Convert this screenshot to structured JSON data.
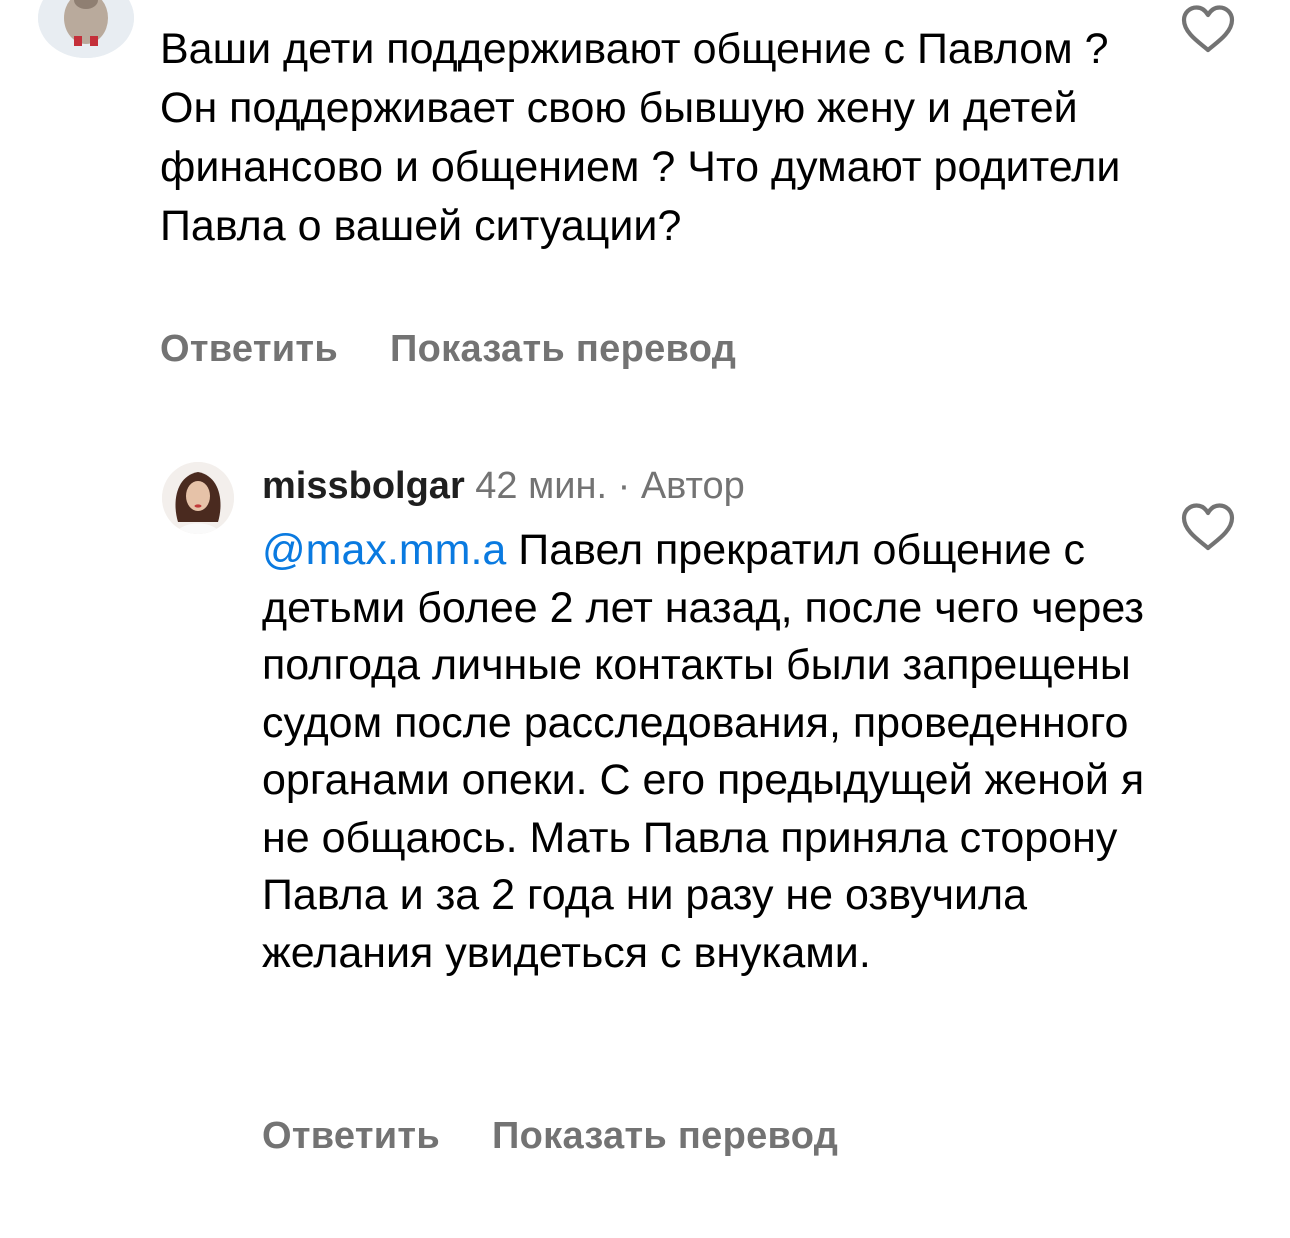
{
  "comments": [
    {
      "text": "Ваши дети поддерживают общение с Павлом ? Он поддерживает свою бывшую жену и детей финансово и общением ? Что думают родители Павла о вашей ситуации?",
      "actions": {
        "reply": "Ответить",
        "translate": "Показать перевод"
      }
    },
    {
      "username": "missbolgar",
      "time": "42 мин.",
      "separator": "·",
      "author_badge": "Автор",
      "mention": "@max.mm.a",
      "text": " Павел прекратил общение с детьми более 2 лет назад, после чего через полгода личные контакты были запрещены судом после расследования, проведенного органами опеки. С его предыдущей женой я не общаюсь. Мать Павла приняла сторону Павла и за 2 года ни разу не озвучила желания увидеться с внуками.",
      "actions": {
        "reply": "Ответить",
        "translate": "Показать перевод"
      }
    }
  ],
  "colors": {
    "text": "#000000",
    "secondary": "#737373",
    "link": "#0a7ae0",
    "background": "#ffffff"
  },
  "icons": {
    "like": "heart-outline-icon"
  }
}
